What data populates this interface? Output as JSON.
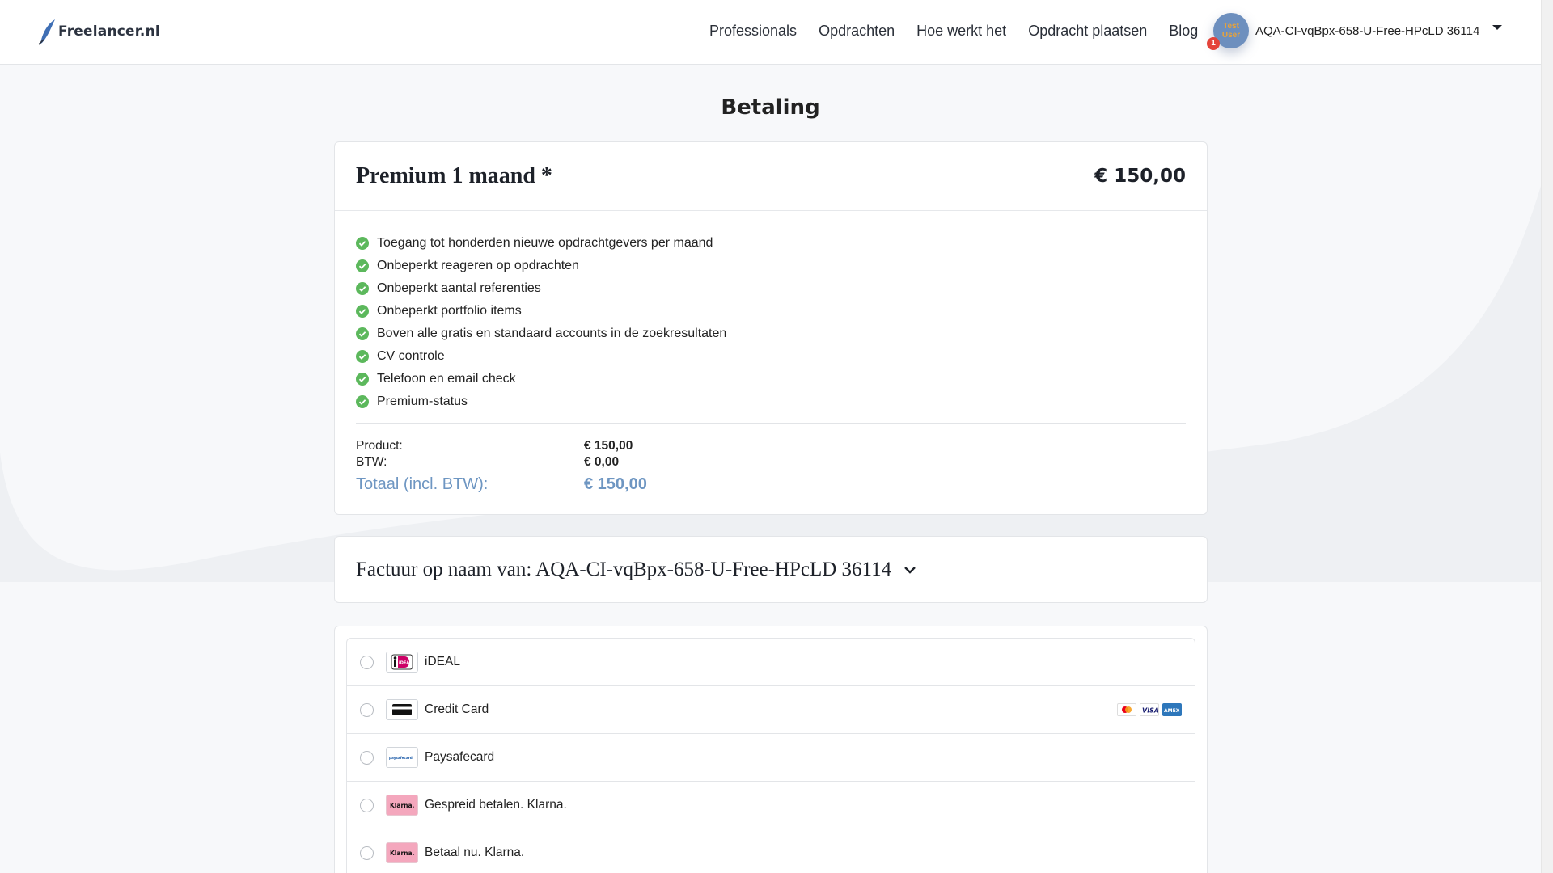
{
  "header": {
    "logo_text": "Freelancer.nl",
    "nav": [
      "Professionals",
      "Opdrachten",
      "Hoe werkt het",
      "Opdracht plaatsen",
      "Blog"
    ],
    "user": {
      "avatar_text_line1": "Test",
      "avatar_text_line2": "User",
      "notification_count": "1",
      "name": "AQA-CI-vqBpx-658-U-Free-HPcLD 36114"
    }
  },
  "page": {
    "title": "Betaling"
  },
  "plan": {
    "name": "Premium 1 maand *",
    "price": "€ 150,00",
    "features": [
      "Toegang tot honderden nieuwe opdrachtgevers per maand",
      "Onbeperkt reageren op opdrachten",
      "Onbeperkt aantal referenties",
      "Onbeperkt portfolio items",
      "Boven alle gratis en standaard accounts in de zoekresultaten",
      "CV controle",
      "Telefoon en email check",
      "Premium-status"
    ]
  },
  "totals": {
    "product_label": "Product:",
    "product_value": "€ 150,00",
    "vat_label": "BTW:",
    "vat_value": "€ 0,00",
    "total_label": "Totaal (incl. BTW):",
    "total_value": "€ 150,00"
  },
  "invoice": {
    "label": "Factuur op naam van: AQA-CI-vqBpx-658-U-Free-HPcLD 36114"
  },
  "payment_methods": [
    {
      "label": "iDEAL",
      "icon": "ideal-icon"
    },
    {
      "label": "Credit Card",
      "icon": "credit-card-icon"
    },
    {
      "label": "Paysafecard",
      "icon": "paysafecard-icon"
    },
    {
      "label": "Gespreid betalen. Klarna.",
      "icon": "klarna-icon"
    },
    {
      "label": "Betaal nu. Klarna.",
      "icon": "klarna-icon"
    }
  ],
  "icon_text": {
    "ideal": "iDEAL",
    "paysafe": "paysafecard",
    "klarna": "Klarna.",
    "visa": "VISA",
    "amex": "AMEX"
  },
  "colors": {
    "accent_blue": "#6e96c2",
    "check_green": "#5cb85c",
    "avatar_bg": "#6d8fbe",
    "badge_red": "#e4433a",
    "klarna_pink": "#f4a7bd"
  }
}
